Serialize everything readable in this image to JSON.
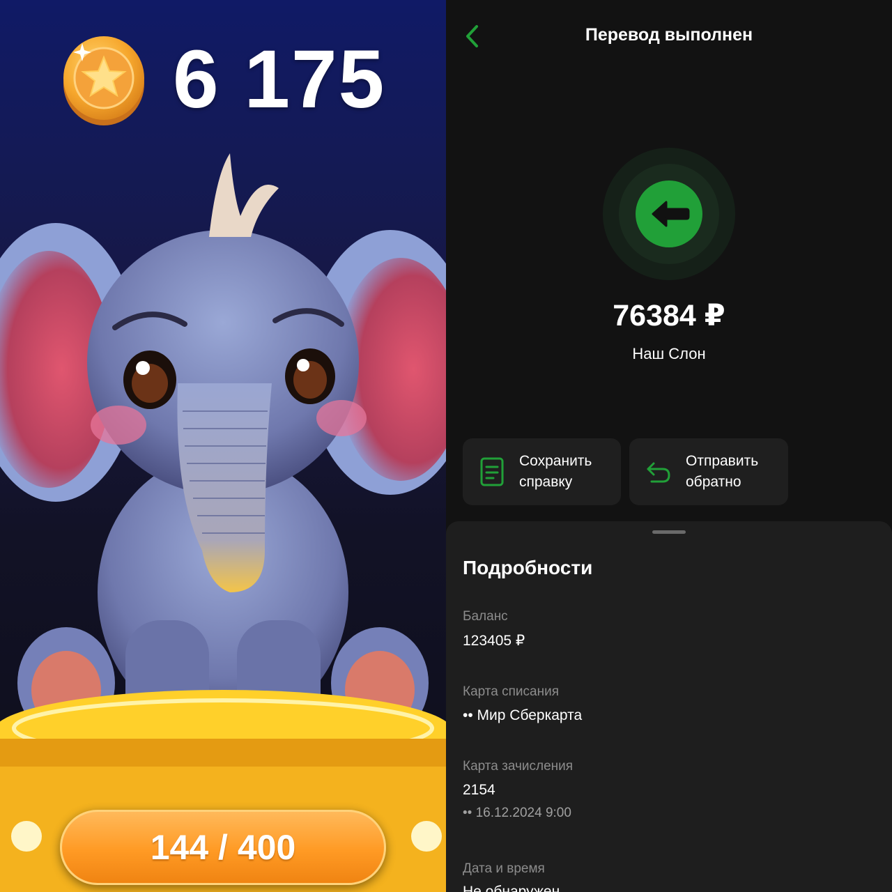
{
  "game": {
    "coin_count": "6 175",
    "progress_label": "144 / 400",
    "progress_current": 144,
    "progress_max": 400,
    "icons": [
      "coin-star-icon"
    ]
  },
  "bank": {
    "title": "Перевод выполнен",
    "amount": "76384 ₽",
    "recipient": "Наш Слон",
    "actions": {
      "save_receipt": "Сохранить справку",
      "send_back": "Отправить обратно"
    },
    "details": {
      "title": "Подробности",
      "balance_label": "Баланс",
      "balance_value": "123405 ₽",
      "debit_card_label": "Карта списания",
      "debit_card_value": "•• Мир Сберкарта",
      "credit_card_label": "Карта зачисления",
      "credit_card_value": "2154",
      "credit_card_sub": "•• 16.12.2024 9:00",
      "datetime_label": "Дата и время",
      "datetime_value": "Не обнаружен"
    },
    "colors": {
      "accent": "#21a038",
      "background": "#121212",
      "card": "#1f1f1f"
    },
    "icons": [
      "chevron-left-icon",
      "arrow-left-icon",
      "document-icon",
      "return-arrow-icon"
    ]
  }
}
